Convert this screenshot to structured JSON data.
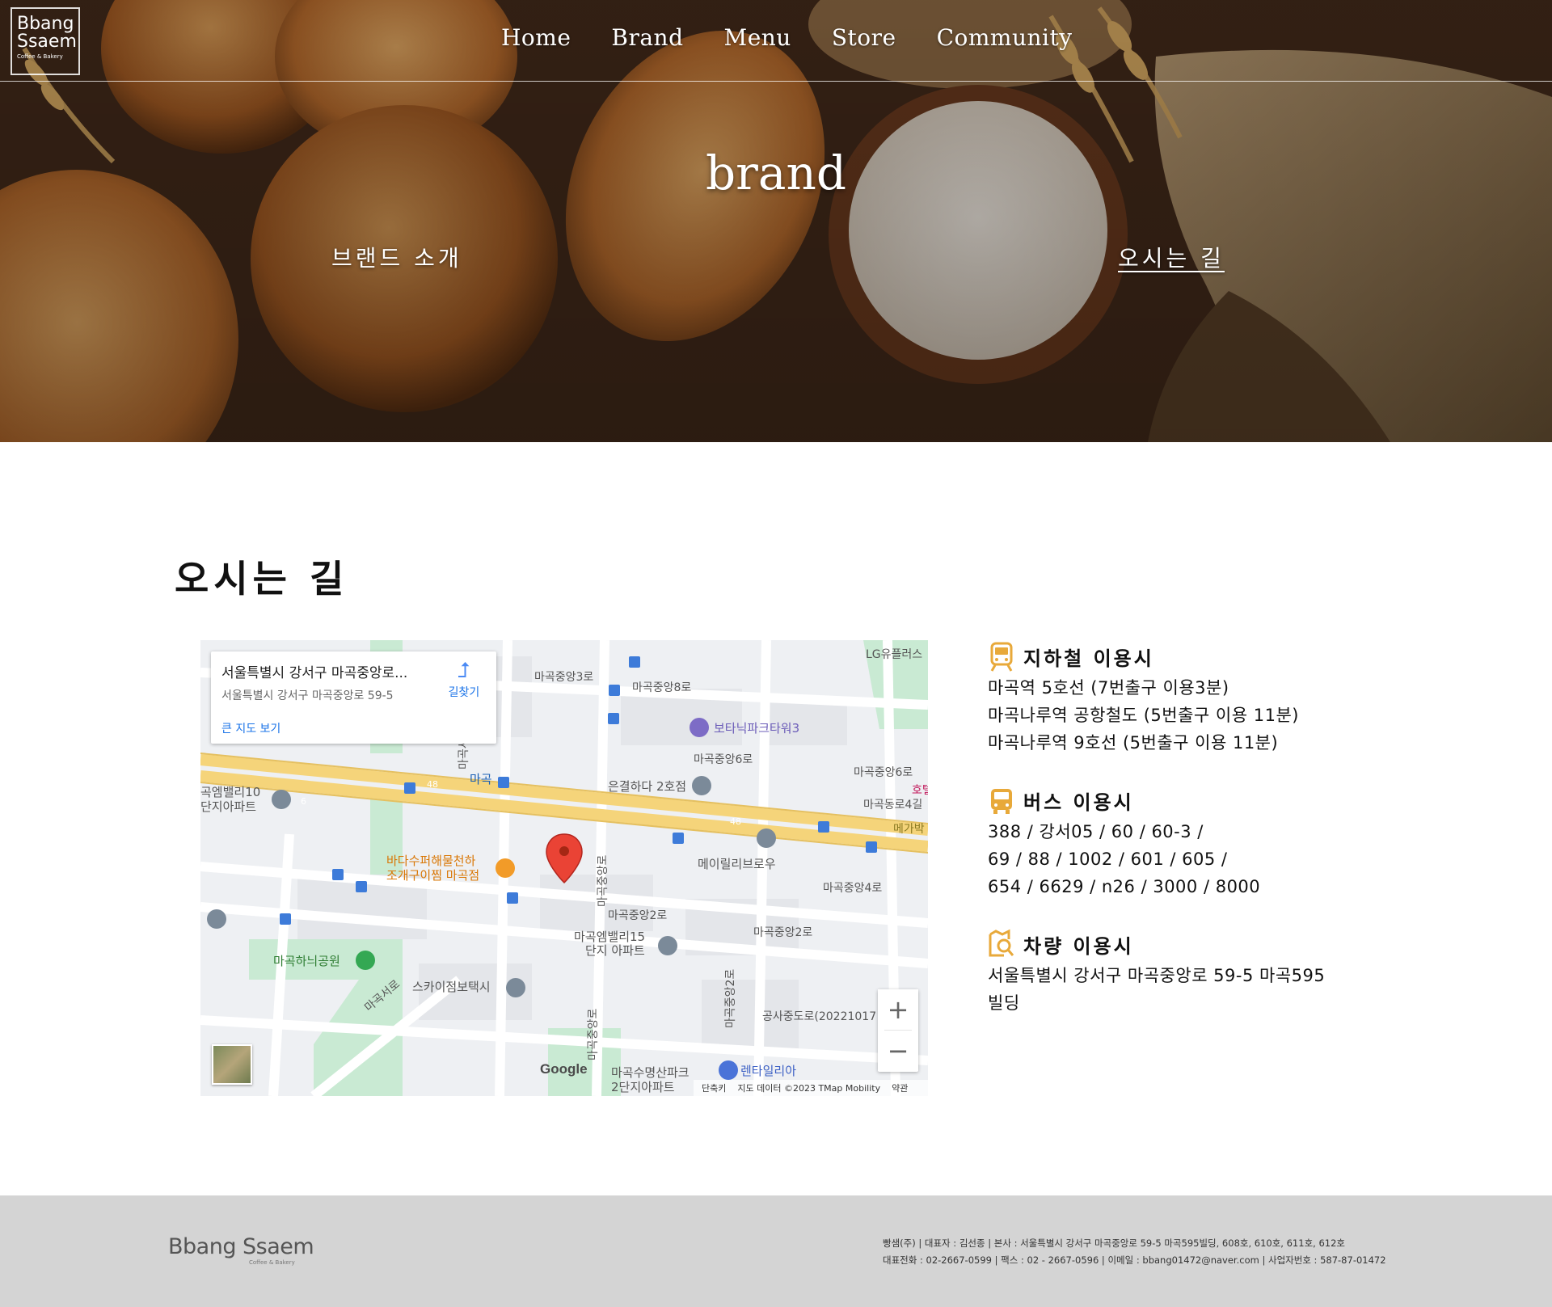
{
  "logo": {
    "line1": "Bbang",
    "line2": "Ssaem",
    "tagline": "Coffee & Bakery"
  },
  "nav": {
    "items": [
      "Home",
      "Brand",
      "Menu",
      "Store",
      "Community"
    ]
  },
  "hero": {
    "title": "brand",
    "link_left": "브랜드 소개",
    "link_right": "오시는 길"
  },
  "section": {
    "title": "오시는 길"
  },
  "map": {
    "card_title": "서울특별시 강서구 마곡중앙로...",
    "card_sub": "서울특별시 강서구 마곡중앙로 59-5",
    "directions": "길찾기",
    "big_map": "큰 지도 보기",
    "google": "Google",
    "footer_shortcut": "단축키",
    "footer_data": "지도 데이터 ©2023 TMap Mobility",
    "footer_terms": "약관",
    "labels": {
      "lg": "LG유플러스",
      "road1": "마곡중앙3로",
      "road2": "마곡중앙8로",
      "botanic": "보타닉파크타워3",
      "road3": "마곡중앙6로",
      "road4": "마곡중앙6로",
      "magok": "마곡",
      "eungyeol": "은결하다 2호점",
      "road5": "마곡동로4길",
      "mega": "메가박",
      "hotel": "호텔",
      "apt10a": "곡엠밸리10",
      "apt10b": "단지아파트",
      "seafood1": "바다수퍼해물천하",
      "seafood2": "조개구이찜 마곡점",
      "maeili": "메이릴리브로우",
      "road6": "마곡중앙4로",
      "road7": "마곡중앙2로",
      "road8": "마곡중앙2로",
      "apt15a": "마곡엠밸리15",
      "apt15b": "단지 아파트",
      "park": "마곡하늬공원",
      "sky": "스카이점보택시",
      "gongsa": "공사중도로(20221017",
      "suyeong1": "마곡수명산파크",
      "suyeong2": "2단지아파트",
      "rental": "렌타일리아",
      "road9": "마곡서로",
      "road10": "마곡중앙로",
      "road11": "마곡중앙로",
      "road12": "마곡중앙2로",
      "road13": "마곡서",
      "bus48a": "48",
      "bus48b": "48",
      "bus6": "6"
    }
  },
  "info": [
    {
      "icon": "subway-icon",
      "title": "지하철 이용시",
      "lines": [
        "마곡역 5호선 (7번출구 이용3분)",
        "마곡나루역 공항철도 (5번출구 이용 11분)",
        "마곡나루역 9호선 (5번출구 이용 11분)"
      ]
    },
    {
      "icon": "bus-icon",
      "title": "버스 이용시",
      "lines": [
        "388 / 강서05 / 60 / 60-3 /",
        "69 / 88 / 1002 / 601 / 605 /",
        "654 / 6629 / n26 / 3000 / 8000"
      ]
    },
    {
      "icon": "car-search-icon",
      "title": "차량 이용시",
      "lines": [
        "서울특별시 강서구 마곡중앙로 59-5 마곡595",
        "빌딩"
      ]
    }
  ],
  "footer": {
    "logo_name": "Bbang Ssaem",
    "logo_tag": "Coffee & Bakery",
    "line1": "빵샘(주) | 대표자 : 김선종 | 본사 : 서울특별시 강서구 마곡중앙로 59-5 마곡595빌딩, 608호, 610호, 611호, 612호",
    "line2": "대표전화 : 02-2667-0599 | 팩스 : 02 - 2667-0596 | 이메일 : bbang01472@naver.com | 사업자번호 : 587-87-01472"
  },
  "colors": {
    "accent": "#e8a93a",
    "footer_bg": "#d4d4d4",
    "map_road": "#f5d47a"
  }
}
